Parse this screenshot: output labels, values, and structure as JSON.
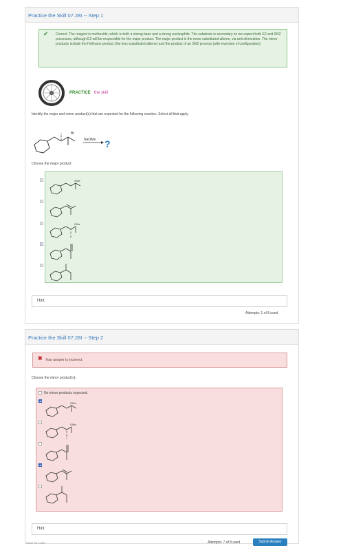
{
  "step1": {
    "title": "Practice the Skill 07.28I -- Step 1",
    "feedback": "Correct. The reagent is methoxide, which is both a strong base and a strong nucleophile. The substrate is secondary so we expect both E2 and SN2 processes, although E2 will be responsible for the major product. The major product is the more-substituted alkene, via anti elimination. The minor products include the Hofmann product (the less-substituted alkene) and the product of an SN2 process (with inversion of configuration).",
    "practice_label_1": "PRACTICE",
    "practice_label_2": "the skill",
    "question": "Identify the major and minor product(s) that are expected for the following reaction. Select all that apply.",
    "reagent": "NaOMe",
    "leaving_group": "Br",
    "product_mark": "?",
    "choose_label": "Choose the major product:",
    "hint": "Hint",
    "attempts": "Attempts: 1 of 8 used",
    "ome_label": "OMe"
  },
  "step2": {
    "title": "Practice the Skill 07.28I -- Step 2",
    "feedback": "Your answer is incorrect.",
    "choose_label": "Choose the minor product(s):",
    "no_minor": "No minor products expected.",
    "hint": "Hint",
    "attempts": "Attempts: 7 of 8 used",
    "save": "Save for Later",
    "submit": "Submit Answer",
    "ome_label": "OMe"
  },
  "colors": {
    "link": "#3a7abf",
    "ok": "#e6f3e4",
    "bad": "#f8dede",
    "accent": "#2a7fbf"
  }
}
